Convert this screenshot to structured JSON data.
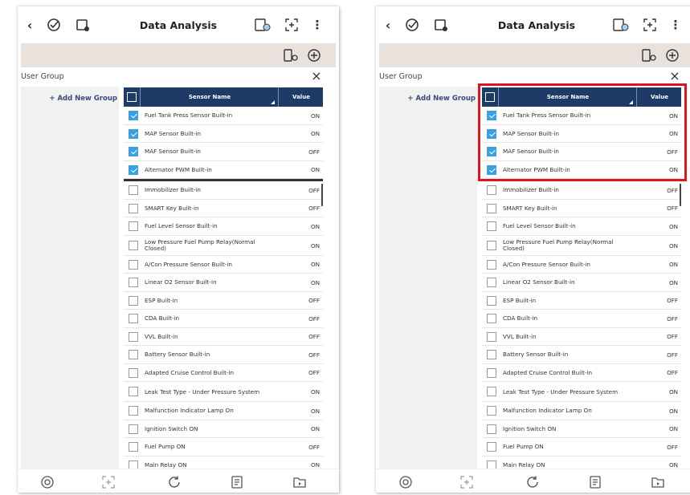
{
  "app": {
    "title": "Data Analysis",
    "user_group_label": "User Group",
    "add_group_label": "+ Add New Group"
  },
  "table": {
    "col_name": "Sensor Name",
    "col_value": "Value",
    "rows": [
      {
        "name": "Fuel Tank Press Sensor Built-in",
        "value": "ON",
        "checked": true
      },
      {
        "name": "MAP Sensor Built-in",
        "value": "ON",
        "checked": true
      },
      {
        "name": "MAF Sensor Built-in",
        "value": "OFF",
        "checked": true
      },
      {
        "name": "Alternator PWM Built-in",
        "value": "ON",
        "checked": true
      },
      {
        "name": "Immobilizer Built-in",
        "value": "OFF",
        "checked": false
      },
      {
        "name": "SMART Key Built-in",
        "value": "OFF",
        "checked": false
      },
      {
        "name": "Fuel Level Sensor Built-in",
        "value": "ON",
        "checked": false
      },
      {
        "name": "Low Pressure Fuel Pump Relay(Normal Closed)",
        "value": "ON",
        "checked": false
      },
      {
        "name": "A/Con Pressure Sensor Built-in",
        "value": "ON",
        "checked": false
      },
      {
        "name": "Linear O2 Sensor Built-in",
        "value": "ON",
        "checked": false
      },
      {
        "name": "ESP Built-in",
        "value": "OFF",
        "checked": false
      },
      {
        "name": "CDA Built-in",
        "value": "OFF",
        "checked": false
      },
      {
        "name": "VVL Built-in",
        "value": "OFF",
        "checked": false
      },
      {
        "name": "Battery Sensor Built-in",
        "value": "OFF",
        "checked": false
      },
      {
        "name": "Adapted Cruise Control Built-in",
        "value": "OFF",
        "checked": false
      },
      {
        "name": "Leak Test Type - Under Pressure System",
        "value": "ON",
        "checked": false
      },
      {
        "name": "Malfunction Indicator Lamp On",
        "value": "ON",
        "checked": false
      },
      {
        "name": "Ignition Switch ON",
        "value": "ON",
        "checked": false
      },
      {
        "name": "Fuel Pump ON",
        "value": "OFF",
        "checked": false
      },
      {
        "name": "Main Relay ON",
        "value": "ON",
        "checked": false
      }
    ]
  },
  "icons": {
    "back": "back-arrow-icon",
    "more": "more-vertical-icon",
    "close": "close-icon"
  },
  "colors": {
    "header": "#1e3a66",
    "check": "#3aa0e0",
    "subbar": "#e9e2dc",
    "highlight": "#e0141a"
  }
}
